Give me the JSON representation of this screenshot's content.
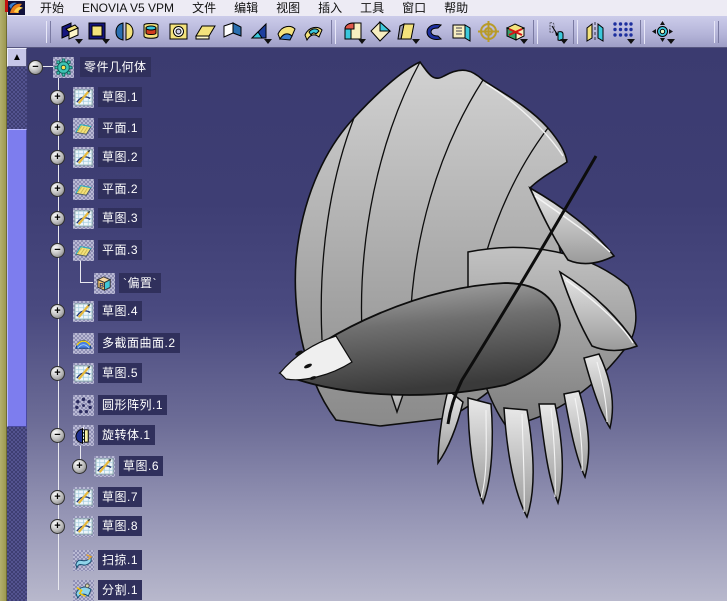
{
  "menu_bar": {
    "app_icon": "catia-logo-icon",
    "items": [
      "开始",
      "ENOVIA V5 VPM",
      "文件",
      "编辑",
      "视图",
      "插入",
      "工具",
      "窗口",
      "帮助"
    ]
  },
  "toolbar": {
    "icon_groups": [
      [
        "pad",
        "pocket",
        "split-body",
        "shaft",
        "hole",
        "rib",
        "slot",
        "stiffener",
        "multi-section-solid",
        "removed-multi-section"
      ],
      [
        "fillet",
        "chamfer",
        "draft",
        "shell",
        "thickness",
        "circular-reference",
        "scale"
      ],
      [
        "translate"
      ],
      [
        "symmetry",
        "rectangular-pattern"
      ],
      [
        "fit-all"
      ]
    ]
  },
  "scrollbar": {
    "up_arrow": "▲"
  },
  "tree": {
    "items": [
      {
        "label": "零件几何体",
        "icon": "part-body-icon",
        "expander": "minus",
        "level": 0
      },
      {
        "label": "草图.1",
        "icon": "sketch-icon",
        "expander": "plus",
        "level": 1
      },
      {
        "label": "平面.1",
        "icon": "plane-icon",
        "expander": "plus",
        "level": 1
      },
      {
        "label": "草图.2",
        "icon": "sketch-icon",
        "expander": "plus",
        "level": 1
      },
      {
        "label": "平面.2",
        "icon": "plane-icon",
        "expander": "plus",
        "level": 1
      },
      {
        "label": "草图.3",
        "icon": "sketch-icon",
        "expander": "plus",
        "level": 1
      },
      {
        "label": "平面.3",
        "icon": "plane-icon",
        "expander": "minus",
        "level": 1
      },
      {
        "label": "`偏置`",
        "icon": "offset-parameter-icon",
        "expander": "none",
        "level": 2
      },
      {
        "label": "草图.4",
        "icon": "sketch-icon",
        "expander": "plus",
        "level": 1
      },
      {
        "label": "多截面曲面.2",
        "icon": "multi-section-surface-icon",
        "expander": "none",
        "level": 1
      },
      {
        "label": "草图.5",
        "icon": "sketch-icon",
        "expander": "plus",
        "level": 1
      },
      {
        "label": "圆形阵列.1",
        "icon": "circular-pattern-icon",
        "expander": "none",
        "level": 1
      },
      {
        "label": "旋转体.1",
        "icon": "shaft-icon",
        "expander": "minus",
        "level": 1
      },
      {
        "label": "草图.6",
        "icon": "sketch-icon",
        "expander": "plus",
        "level": 2
      },
      {
        "label": "草图.7",
        "icon": "sketch-icon",
        "expander": "plus",
        "level": 1
      },
      {
        "label": "草图.8",
        "icon": "sketch-icon",
        "expander": "plus",
        "level": 1
      },
      {
        "label": "扫掠.1",
        "icon": "sweep-icon",
        "expander": "none",
        "level": 1
      },
      {
        "label": "分割.1",
        "icon": "split-icon",
        "expander": "none",
        "level": 1
      }
    ]
  },
  "viewport": {
    "model": "turbofan-impeller-3d-model",
    "colors": {
      "background_top": "#3b3b70",
      "background_bottom": "#b8b8cc",
      "blade_gray": "#c0c0c0",
      "cone_dark": "#4a4a4a",
      "outline": "#0d0d0d",
      "tree_label_bg": "#30305c"
    }
  }
}
